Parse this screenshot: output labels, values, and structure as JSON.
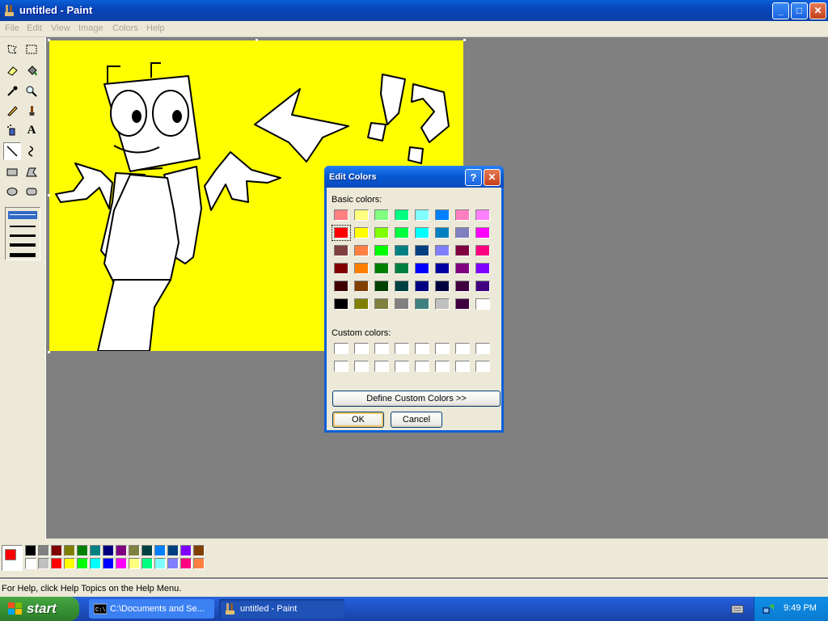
{
  "window": {
    "title": "untitled - Paint",
    "minimize": "_",
    "maximize": "□",
    "close": "✕"
  },
  "menu": [
    "File",
    "Edit",
    "View",
    "Image",
    "Colors",
    "Help"
  ],
  "status": {
    "text": "For Help, click Help Topics on the Help Menu."
  },
  "palette": {
    "foreground": "#ff0000",
    "background": "#ffffff",
    "row1": [
      "#000000",
      "#808080",
      "#800000",
      "#808000",
      "#008000",
      "#008080",
      "#000080",
      "#800080",
      "#808040",
      "#004040",
      "#0080ff",
      "#004080",
      "#8000ff",
      "#804000"
    ],
    "row2": [
      "#ffffff",
      "#c0c0c0",
      "#ff0000",
      "#ffff00",
      "#00ff00",
      "#00ffff",
      "#0000ff",
      "#ff00ff",
      "#ffff80",
      "#00ff80",
      "#80ffff",
      "#8080ff",
      "#ff0080",
      "#ff8040"
    ]
  },
  "dialog": {
    "title": "Edit Colors",
    "help_button": "?",
    "close_button": "✕",
    "basic_colors_label": "Basic colors:",
    "custom_colors_label": "Custom colors:",
    "define_button": "Define Custom Colors >>",
    "ok_button": "OK",
    "cancel_button": "Cancel",
    "selected_index": 8,
    "basic_colors": [
      "#ff8080",
      "#ffff80",
      "#80ff80",
      "#00ff80",
      "#80ffff",
      "#0080ff",
      "#ff80c0",
      "#ff80ff",
      "#ff0000",
      "#ffff00",
      "#80ff00",
      "#00ff40",
      "#00ffff",
      "#0080c0",
      "#8080c0",
      "#ff00ff",
      "#804040",
      "#ff8040",
      "#00ff00",
      "#008080",
      "#004080",
      "#8080ff",
      "#800040",
      "#ff0080",
      "#800000",
      "#ff8000",
      "#008000",
      "#008040",
      "#0000ff",
      "#0000a0",
      "#800080",
      "#8000ff",
      "#400000",
      "#804000",
      "#004000",
      "#004040",
      "#000080",
      "#000040",
      "#400040",
      "#400080",
      "#000000",
      "#808000",
      "#808040",
      "#808080",
      "#408080",
      "#c0c0c0",
      "#400040",
      "#ffffff"
    ]
  },
  "taskbar": {
    "start": "start",
    "tasks": [
      {
        "label": "C:\\Documents and Se...",
        "active": false
      },
      {
        "label": "untitled - Paint",
        "active": true
      }
    ],
    "clock": "9:49 PM"
  }
}
